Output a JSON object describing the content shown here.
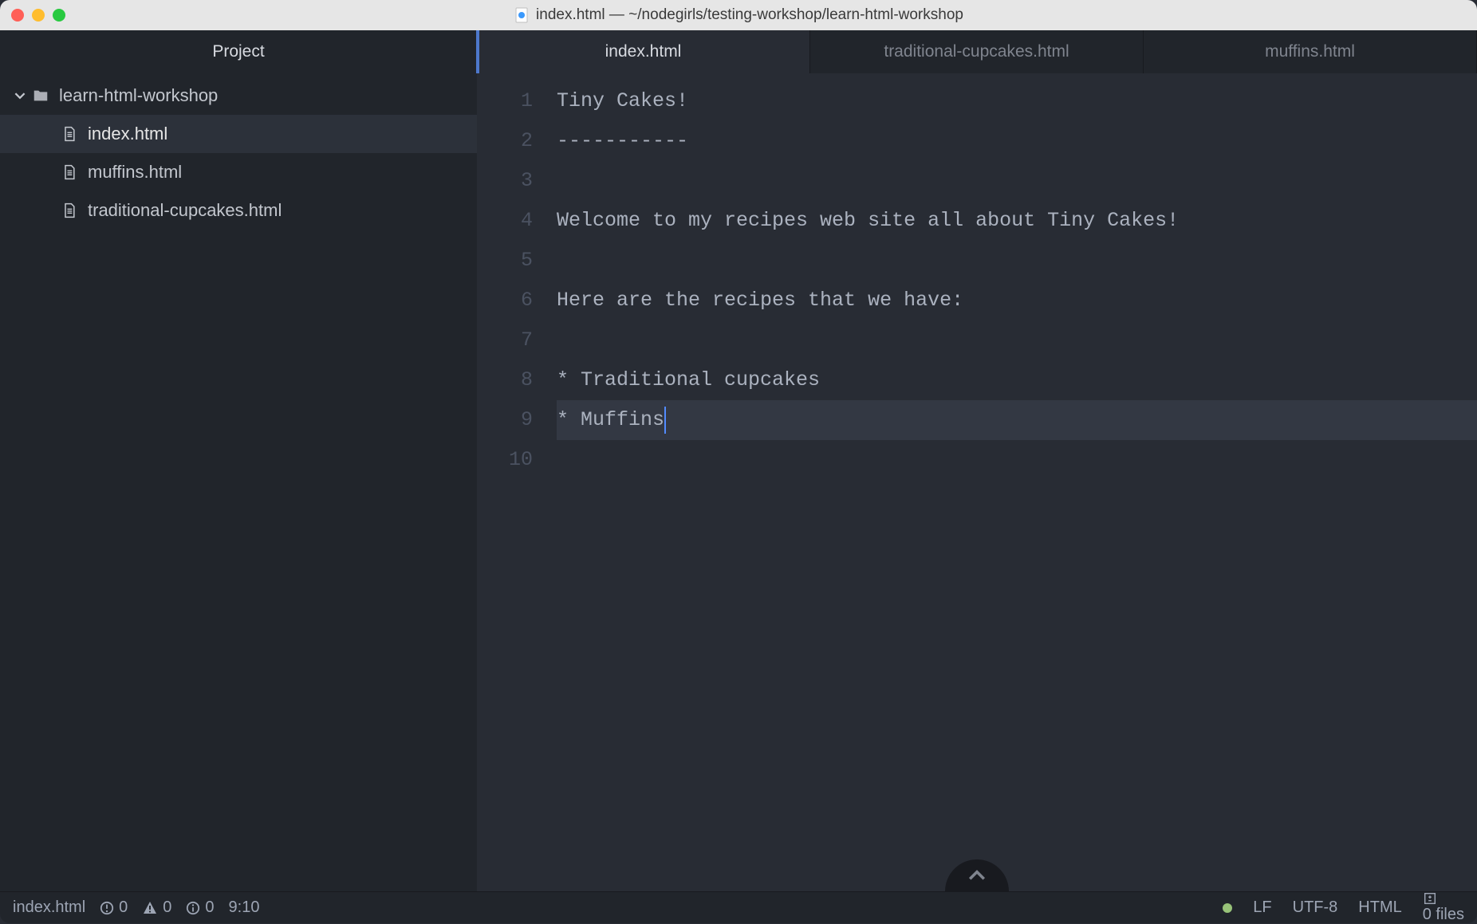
{
  "titlebar": {
    "title": "index.html — ~/nodegirls/testing-workshop/learn-html-workshop"
  },
  "sidebar": {
    "header": "Project",
    "tree": {
      "root": {
        "label": "learn-html-workshop"
      },
      "files": [
        {
          "label": "index.html",
          "selected": true
        },
        {
          "label": "muffins.html",
          "selected": false
        },
        {
          "label": "traditional-cupcakes.html",
          "selected": false
        }
      ]
    }
  },
  "tabs": [
    {
      "label": "index.html",
      "active": true
    },
    {
      "label": "traditional-cupcakes.html",
      "active": false
    },
    {
      "label": "muffins.html",
      "active": false
    }
  ],
  "editor": {
    "line_numbers": [
      "1",
      "2",
      "3",
      "4",
      "5",
      "6",
      "7",
      "8",
      "9",
      "10"
    ],
    "lines": [
      "Tiny Cakes!",
      "-----------",
      "",
      "Welcome to my recipes web site all about Tiny Cakes!",
      "",
      "Here are the recipes that we have:",
      "",
      "* Traditional cupcakes",
      "* Muffins",
      ""
    ],
    "current_line_index": 8,
    "cursor_col_chars": 9
  },
  "statusbar": {
    "filename": "index.html",
    "diagnostics": {
      "deprecations": "0",
      "errors": "0",
      "infos": "0"
    },
    "cursor_pos": "9:10",
    "line_ending": "LF",
    "encoding": "UTF-8",
    "grammar": "HTML",
    "git_files": "0 files"
  }
}
